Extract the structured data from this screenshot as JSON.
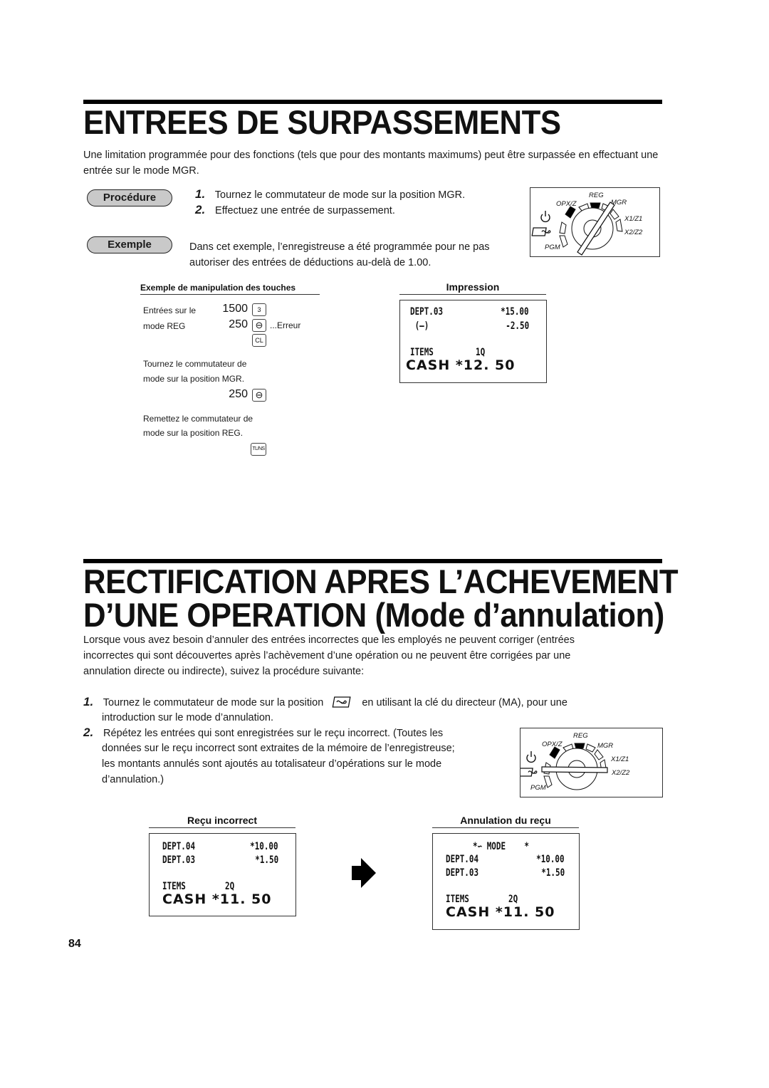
{
  "section1": {
    "title": "ENTREES DE SURPASSEMENTS",
    "intro": "Une limitation programmée pour des fonctions (tels que pour des montants maximums) peut être surpassée en effectuant une entrée sur le mode MGR.",
    "procedure_label": "Procédure",
    "steps": [
      {
        "num": "1.",
        "text": "Tournez le commutateur de mode sur la position MGR."
      },
      {
        "num": "2.",
        "text": "Effectuez une entrée de surpassement."
      }
    ],
    "example_label": "Exemple",
    "example_text_1": "Dans cet exemple, l’enregistreuse a été programmée pour ne pas",
    "example_text_2": "autoriser des entrées de déductions au-delà de 1.00.",
    "dial": {
      "labels": {
        "reg": "REG",
        "opxz": "OPX/Z",
        "mgr": "MGR",
        "x1z1": "X1/Z1",
        "x2z2": "X2/Z2",
        "pgm": "PGM"
      },
      "position": "MGR"
    },
    "key_ops": {
      "heading": "Exemple de manipulation des touches",
      "entries_label_1": "Entrées sur le",
      "entries_label_2": "mode REG",
      "amount_1": "1500",
      "key_1": "3",
      "amount_2": "250",
      "key_minus": "⊖",
      "error": "...Erreur",
      "key_cl": "CL",
      "turn_mgr_1": "Tournez le commutateur de",
      "turn_mgr_2": "mode sur la position MGR.",
      "amount_3": "250",
      "return_reg_1": "Remettez le commutateur de",
      "return_reg_2": "mode sur la position REG.",
      "key_tlns": "TL/NS"
    },
    "impression": {
      "heading": "Impression",
      "lines": [
        {
          "left": "DEPT.03",
          "right": "*15.00"
        },
        {
          "left": " (—)",
          "right": "-2.50"
        }
      ],
      "items_label": "ITEMS",
      "items_count": "1Q",
      "cash": "CASH *12. 50"
    }
  },
  "section2": {
    "title_line1": "RECTIFICATION APRES L’ACHEVEMENT",
    "title_line2": "D’UNE OPERATION  (Mode d’annulation)",
    "intro_1": "Lorsque vous avez besoin d’annuler des entrées incorrectes que les employés ne peuvent corriger (entrées",
    "intro_2": "incorrectes qui sont découvertes après l’achèvement d’une opération ou ne peuvent être corrigées par une",
    "intro_3": "annulation directe ou indirecte), suivez la procédure suivante:",
    "steps": [
      {
        "num": "1.",
        "text_a": "Tournez le commutateur de mode sur la position",
        "text_b": "en utilisant la clé du directeur (MA), pour une",
        "text_c": "introduction sur le mode d’annulation."
      },
      {
        "num": "2.",
        "lines": [
          "Répétez les entrées qui sont enregistrées sur le reçu incorrect. (Toutes les",
          "données sur le reçu incorrect sont extraites de la mémoire de l’enregistreuse;",
          "les montants annulés sont ajoutés au totalisateur d’opérations sur le mode",
          "d’annulation.)"
        ]
      }
    ],
    "dial": {
      "labels": {
        "reg": "REG",
        "opxz": "OPX/Z",
        "mgr": "MGR",
        "x1z1": "X1/Z1",
        "x2z2": "X2/Z2",
        "pgm": "PGM"
      },
      "position": "VOID"
    },
    "receipt_incorrect": {
      "heading": "Reçu incorrect",
      "lines": [
        {
          "left": "DEPT.04",
          "right": "*10.00"
        },
        {
          "left": "DEPT.03",
          "right": "*1.50"
        }
      ],
      "items_label": "ITEMS",
      "items_count": "2Q",
      "cash": "CASH *11. 50"
    },
    "receipt_void": {
      "heading": "Annulation du reçu",
      "mode_line": "*∽ MODE    *",
      "lines": [
        {
          "left": "DEPT.04",
          "right": "*10.00"
        },
        {
          "left": "DEPT.03",
          "right": "*1.50"
        }
      ],
      "items_label": "ITEMS",
      "items_count": "2Q",
      "cash": "CASH *11. 50"
    }
  },
  "page_number": "84"
}
